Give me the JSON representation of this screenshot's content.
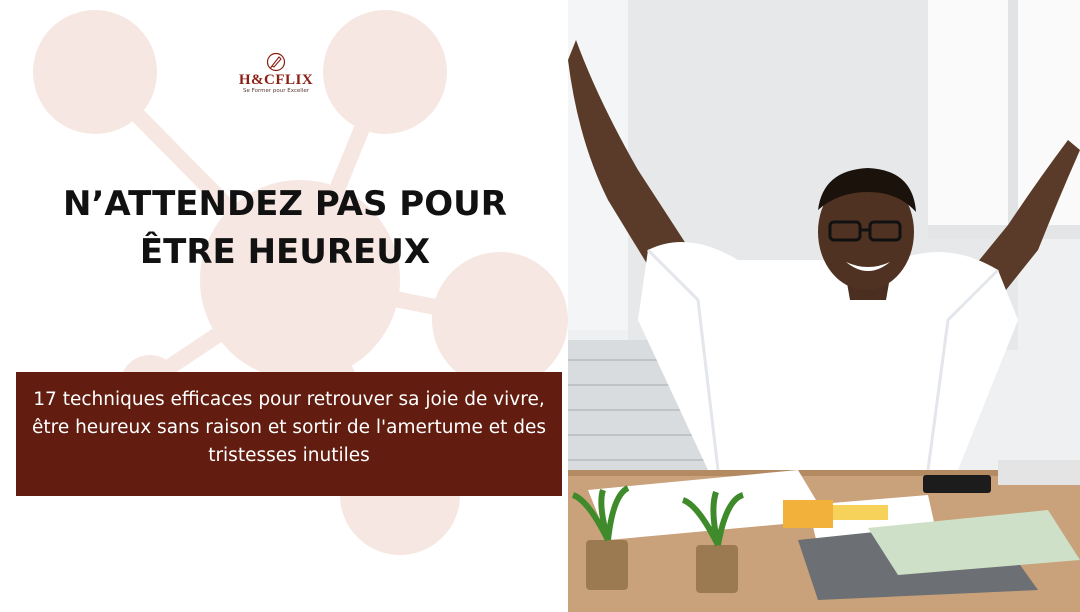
{
  "brand": {
    "name": "H&CFLIX",
    "tagline": "Se Former pour Exceller",
    "mark_icon": "pen-nib-icon",
    "color": "#8a1f14"
  },
  "headline": {
    "line1": "N’ATTENDEZ PAS POUR",
    "line2": "ÊTRE HEUREUX"
  },
  "subtitle": {
    "text": "17 techniques efficaces pour retrouver sa joie de vivre, être heureux sans raison et sortir de l'amertume et des tristesses inutiles"
  },
  "colors": {
    "accent_box": "#621d10",
    "decor": "#f6e7e2",
    "headline_text": "#111111"
  },
  "photo": {
    "subject": "happy-man-at-desk-photo"
  }
}
